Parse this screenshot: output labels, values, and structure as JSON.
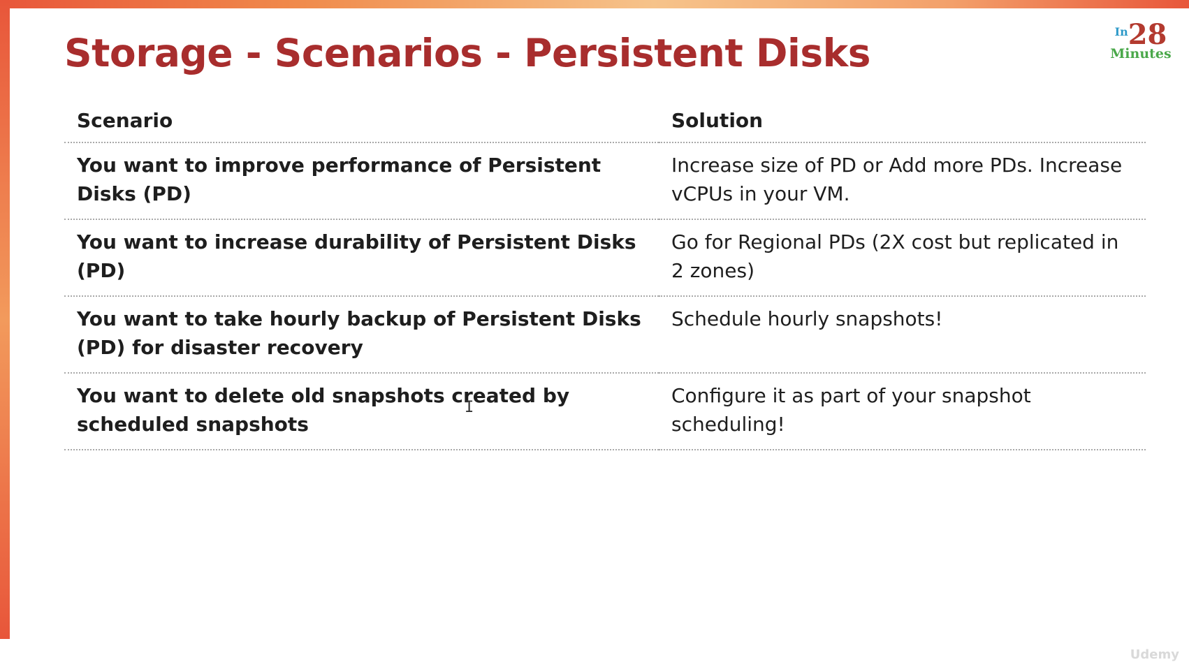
{
  "slide": {
    "title": "Storage - Scenarios - Persistent Disks"
  },
  "logo": {
    "prefix": "In",
    "number": "28",
    "suffix": "Minutes"
  },
  "table": {
    "headers": [
      "Scenario",
      "Solution"
    ],
    "rows": [
      {
        "scenario": "You want to improve performance of Persistent Disks (PD)",
        "solution": "Increase size of PD or Add more PDs. Increase vCPUs in your VM."
      },
      {
        "scenario": "You want to increase durability of Persistent Disks (PD)",
        "solution": "Go for Regional PDs (2X cost but replicated in 2 zones)"
      },
      {
        "scenario": "You want to take hourly backup of Persistent Disks (PD) for disaster recovery",
        "solution": "Schedule hourly snapshots!"
      },
      {
        "scenario": "You want to delete old snapshots created by scheduled snapshots",
        "solution": "Configure it as part of your snapshot scheduling!"
      }
    ]
  },
  "watermark": "Udemy",
  "colors": {
    "title": "#a82d2d",
    "accent_bar": "#e8563a",
    "logo_in": "#2e9ac9",
    "logo_number": "#b33a2f",
    "logo_minutes": "#4aa84a"
  }
}
